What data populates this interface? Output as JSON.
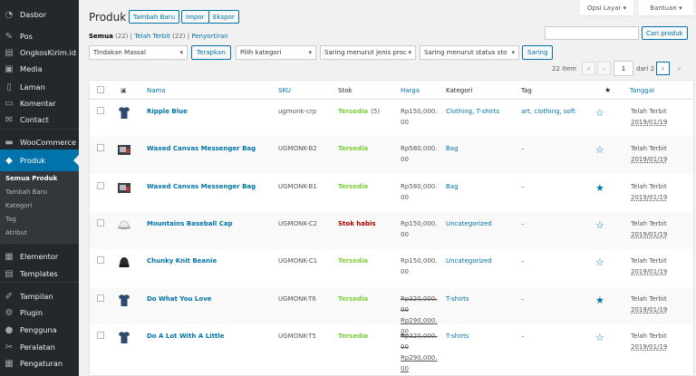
{
  "menu": {
    "items": [
      {
        "label": "Dasbor",
        "icon": "dashboard-icon",
        "glyph": "◔"
      },
      {
        "label": "Pos",
        "icon": "pin-icon",
        "glyph": "✎"
      },
      {
        "label": "OngkosKirim.id",
        "icon": "truck-icon",
        "glyph": "▤"
      },
      {
        "label": "Media",
        "icon": "media-icon",
        "glyph": "▣"
      },
      {
        "label": "Laman",
        "icon": "pages-icon",
        "glyph": "▯"
      },
      {
        "label": "Komentar",
        "icon": "comment-icon",
        "glyph": "▭"
      },
      {
        "label": "Contact",
        "icon": "mail-icon",
        "glyph": "✉"
      },
      {
        "label": "WooCommerce",
        "icon": "woocommerce-icon",
        "glyph": "▬"
      },
      {
        "label": "Produk",
        "icon": "product-icon",
        "glyph": "◆"
      },
      {
        "label": "Elementor",
        "icon": "elementor-icon",
        "glyph": "▦"
      },
      {
        "label": "Templates",
        "icon": "templates-icon",
        "glyph": "▤"
      },
      {
        "label": "Tampilan",
        "icon": "appearance-icon",
        "glyph": "✐"
      },
      {
        "label": "Plugin",
        "icon": "plugin-icon",
        "glyph": "⚙"
      },
      {
        "label": "Pengguna",
        "icon": "users-icon",
        "glyph": "●"
      },
      {
        "label": "Peralatan",
        "icon": "tools-icon",
        "glyph": "✂"
      },
      {
        "label": "Pengaturan",
        "icon": "settings-icon",
        "glyph": "▦"
      }
    ],
    "submenu": [
      "Semua Produk",
      "Tambah Baru",
      "Kategori",
      "Tag",
      "Atribut"
    ]
  },
  "screen_options": "Opsi Layar ▾",
  "help": "Bantuan ▾",
  "page_title": "Produk",
  "buttons": {
    "add": "Tambah Baru",
    "import": "Impor",
    "export": "Ekspor"
  },
  "subsubsub": {
    "all": "Semua",
    "all_count": "(22)",
    "published": "Telah Terbit",
    "published_count": "(22)",
    "sort": "Penyortiran",
    "sep": "|"
  },
  "search": {
    "button": "Cari produk",
    "value": ""
  },
  "filters": {
    "bulk": "Tindakan Massal",
    "apply": "Terapkan",
    "category": "Pilih kategori",
    "type": "Saring menurut jenis proc",
    "stock": "Saring menurut status sto",
    "filter": "Saring"
  },
  "pagination": {
    "count": "22 item",
    "first": "«",
    "prev": "‹",
    "current": "1",
    "of": "dari 2",
    "next": "›",
    "last": "»"
  },
  "columns": {
    "name": "Nama",
    "sku": "SKU",
    "stock": "Stok",
    "price": "Harga",
    "category": "Kategori",
    "tag": "Tag",
    "featured": "★",
    "date": "Tanggal"
  },
  "rows": [
    {
      "name": "Ripple Blue",
      "sku": "ugmonk-crp",
      "stock": "Tersedia",
      "stock_qty": "(5)",
      "in_stock": true,
      "price": [
        "Rp150,000."
      ],
      "sale": [
        "00"
      ],
      "old": false,
      "category": "Clothing, T-shirts",
      "tag": "art, clothing, soft",
      "featured": false,
      "date": "Telah Terbit",
      "date2": "2019/01/19",
      "thumb": "tshirt"
    },
    {
      "name": "Waxed Canvas Messenger Bag",
      "sku": "UGMONK-B2",
      "stock": "Tersedia",
      "stock_qty": "",
      "in_stock": true,
      "price": [
        "Rp580,000."
      ],
      "sale": [
        "00"
      ],
      "old": false,
      "category": "Bag",
      "tag": "–",
      "featured": false,
      "date": "Telah Terbit",
      "date2": "2019/01/19",
      "thumb": "bag"
    },
    {
      "name": "Waxed Canvas Messenger Bag",
      "sku": "UGMONK-B1",
      "stock": "Tersedia",
      "stock_qty": "",
      "in_stock": true,
      "price": [
        "Rp580,000."
      ],
      "sale": [
        "00"
      ],
      "old": false,
      "category": "Bag",
      "tag": "–",
      "featured": true,
      "date": "Telah Terbit",
      "date2": "2019/01/19",
      "thumb": "bag"
    },
    {
      "name": "Mountains Baseball Cap",
      "sku": "UGMONK-C2",
      "stock": "Stok habis",
      "stock_qty": "",
      "in_stock": false,
      "price": [
        "Rp150,000."
      ],
      "sale": [
        "00"
      ],
      "old": false,
      "category": "Uncategorized",
      "tag": "–",
      "featured": false,
      "date": "Telah Terbit",
      "date2": "2019/01/19",
      "thumb": "cap"
    },
    {
      "name": "Chunky Knit Beanie",
      "sku": "UGMONK-C1",
      "stock": "Tersedia",
      "stock_qty": "",
      "in_stock": true,
      "price": [
        "Rp150,000."
      ],
      "sale": [
        "00"
      ],
      "old": false,
      "category": "Uncategorized",
      "tag": "–",
      "featured": false,
      "date": "Telah Terbit",
      "date2": "2019/01/19",
      "thumb": "beanie"
    },
    {
      "name": "Do What You Love",
      "sku": "UGMONK-T6",
      "stock": "Tersedia",
      "stock_qty": "",
      "in_stock": true,
      "price": [
        "Rp320,000.",
        "00"
      ],
      "sale": [
        "Rp290,000.",
        "00"
      ],
      "old": true,
      "category": "T-shirts",
      "tag": "–",
      "featured": true,
      "date": "Telah Terbit",
      "date2": "2019/01/19",
      "thumb": "tshirt"
    },
    {
      "name": "Do A Lot With A Little",
      "sku": "UGMONK-T5",
      "stock": "Tersedia",
      "stock_qty": "",
      "in_stock": true,
      "price": [
        "Rp320,000.",
        "00"
      ],
      "sale": [
        "Rp290,000.",
        "00"
      ],
      "old": true,
      "category": "T-shirts",
      "tag": "–",
      "featured": false,
      "date": "Telah Terbit",
      "date2": "2019/01/19",
      "thumb": "tshirt"
    }
  ],
  "colors": {
    "accent": "#0073aa",
    "in_stock": "#7ad03a",
    "out_stock": "#a00",
    "menu_bg": "#23282d"
  }
}
